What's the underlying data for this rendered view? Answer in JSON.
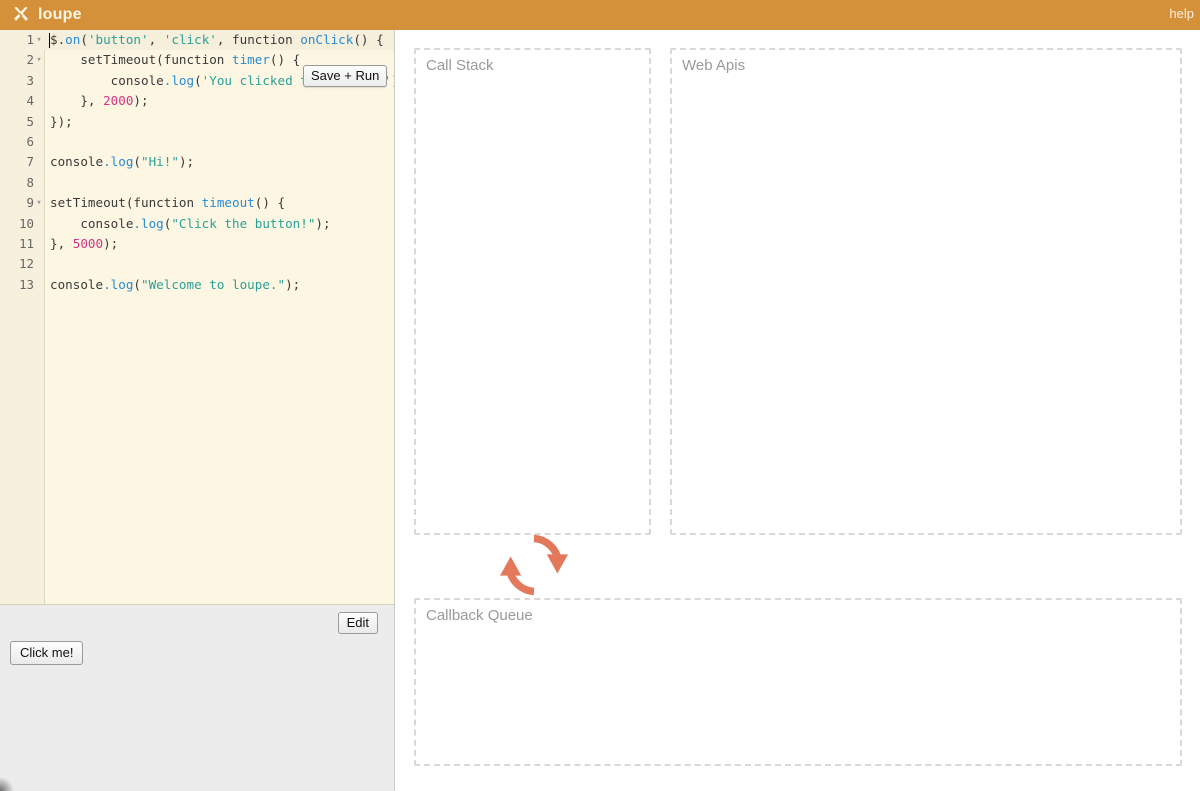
{
  "header": {
    "brand_title": "loupe",
    "brand_icon": "crossed-tools-icon",
    "help_label": "help",
    "bar_color": "#d4913a",
    "title_color": "#fdf6e8"
  },
  "editor": {
    "background": "#fdf6e3",
    "active_line": 1,
    "save_run_label": "Save + Run",
    "lines": [
      {
        "num": "1",
        "foldable": true,
        "text": "$.on('button', 'click', function onClick() {"
      },
      {
        "num": "2",
        "foldable": true,
        "text": "    setTimeout(function timer() {"
      },
      {
        "num": "3",
        "foldable": false,
        "text": "        console.log('You clicked the button!');"
      },
      {
        "num": "4",
        "foldable": false,
        "text": "    }, 2000);"
      },
      {
        "num": "5",
        "foldable": false,
        "text": "});"
      },
      {
        "num": "6",
        "foldable": false,
        "text": ""
      },
      {
        "num": "7",
        "foldable": false,
        "text": "console.log(\"Hi!\");"
      },
      {
        "num": "8",
        "foldable": false,
        "text": ""
      },
      {
        "num": "9",
        "foldable": true,
        "text": "setTimeout(function timeout() {"
      },
      {
        "num": "10",
        "foldable": false,
        "text": "    console.log(\"Click the button!\");"
      },
      {
        "num": "11",
        "foldable": false,
        "text": "}, 5000);"
      },
      {
        "num": "12",
        "foldable": false,
        "text": ""
      },
      {
        "num": "13",
        "foldable": false,
        "text": "console.log(\"Welcome to loupe.\");"
      }
    ],
    "syntax_colors": {
      "string": "#2aa198",
      "number": "#d33682",
      "function_name": "#268bd2",
      "default": "#3a3a3a"
    }
  },
  "console_pane": {
    "click_me_label": "Click me!",
    "edit_label": "Edit",
    "background": "#ececec"
  },
  "panels": {
    "call_stack": {
      "label": "Call Stack",
      "items": []
    },
    "web_apis": {
      "label": "Web Apis",
      "items": []
    },
    "callback_queue": {
      "label": "Callback Queue",
      "items": []
    },
    "border_color": "#d8d8d8",
    "label_color": "#9a9a9a"
  },
  "event_loop": {
    "icon": "circular-loop-icon",
    "color": "#e3795a"
  }
}
